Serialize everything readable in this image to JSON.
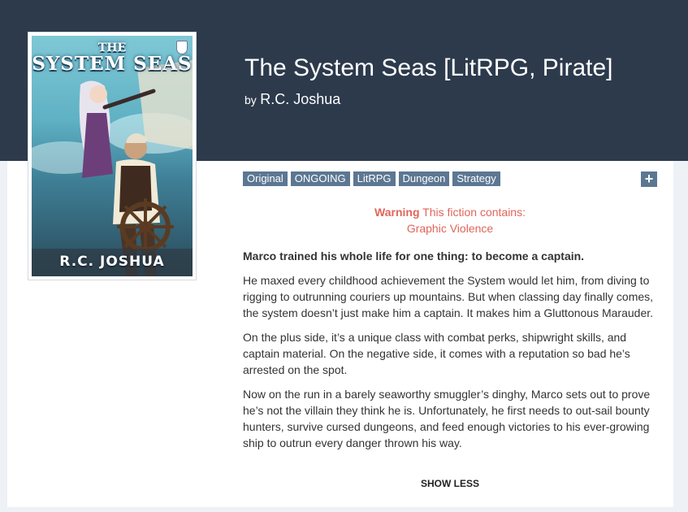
{
  "fiction": {
    "title": "The System Seas [LitRPG, Pirate]",
    "by_label": "by",
    "author": "R.C. Joshua"
  },
  "cover": {
    "title_small": "THE",
    "title_big": "SYSTEM SEAS",
    "author": "R.C. JOSHUA"
  },
  "tags": [
    "Original",
    "ONGOING",
    "LitRPG",
    "Dungeon",
    "Strategy"
  ],
  "expand_tags_label": "+",
  "warning": {
    "label": "Warning",
    "text": "This fiction contains:",
    "items": [
      "Graphic Violence"
    ]
  },
  "description": {
    "lead": "Marco trained his whole life for one thing: to become a captain.",
    "paragraphs": [
      "He maxed every childhood achievement the System would let him, from diving to rigging to outrunning couriers up mountains. But when classing day finally comes, the system doesn’t just make him a captain. It makes him a Gluttonous Marauder.",
      "On the plus side, it’s a unique class with combat perks, shipwright skills, and captain material. On the negative side, it comes with a reputation so bad he’s arrested on the spot.",
      "Now on the run in a barely seaworthy smuggler’s dinghy, Marco sets out to prove he’s not the villain they think he is. Unfortunately, he first needs to out-sail bounty hunters, survive cursed dungeons, and feed enough victories to his ever-growing ship to outrun every danger thrown his way."
    ]
  },
  "show_less_label": "SHOW LESS",
  "colors": {
    "header_bg": "#2c3a4c",
    "tag_bg": "#5c7792",
    "warning": "#e0655b"
  }
}
